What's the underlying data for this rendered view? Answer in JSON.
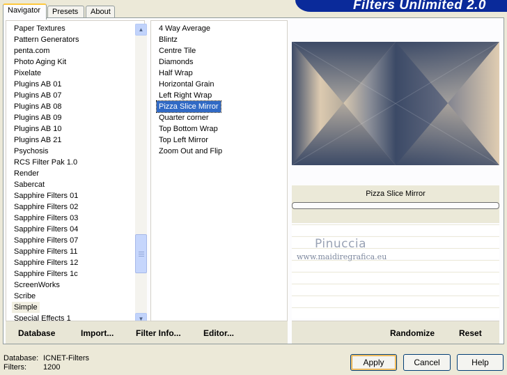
{
  "banner": {
    "title": "Filters Unlimited 2.0"
  },
  "tabs": [
    {
      "label": "Navigator",
      "active": true
    },
    {
      "label": "Presets",
      "active": false
    },
    {
      "label": "About",
      "active": false
    }
  ],
  "categories": {
    "items": [
      "Paper Textures",
      "Pattern Generators",
      "penta.com",
      "Photo Aging Kit",
      "Pixelate",
      "Plugins AB 01",
      "Plugins AB 07",
      "Plugins AB 08",
      "Plugins AB 09",
      "Plugins AB 10",
      "Plugins AB 21",
      "Psychosis",
      "RCS Filter Pak 1.0",
      "Render",
      "Sabercat",
      "Sapphire Filters 01",
      "Sapphire Filters 02",
      "Sapphire Filters 03",
      "Sapphire Filters 04",
      "Sapphire Filters 07",
      "Sapphire Filters 11",
      "Sapphire Filters 12",
      "Sapphire Filters 1c",
      "ScreenWorks",
      "Scribe",
      "Simple",
      "Special Effects 1"
    ],
    "highlighted": "Simple"
  },
  "filters": {
    "items": [
      "4 Way Average",
      "Blintz",
      "Centre Tile",
      "Diamonds",
      "Half Wrap",
      "Horizontal Grain",
      "Left Right Wrap",
      "Pizza Slice Mirror",
      "Quarter corner",
      "Top Bottom Wrap",
      "Top Left Mirror",
      "Zoom Out and Flip"
    ],
    "selected": "Pizza Slice Mirror"
  },
  "left_bar": {
    "database": "Database",
    "import": "Import...",
    "filter_info": "Filter Info...",
    "editor": "Editor..."
  },
  "right_bar": {
    "randomize": "Randomize",
    "reset": "Reset"
  },
  "preview": {
    "filter_name": "Pizza Slice Mirror"
  },
  "watermark": {
    "name": "Pinuccia",
    "url": "www.maidiregrafica.eu"
  },
  "footer": {
    "database_label": "Database:",
    "database_value": "ICNET-Filters",
    "filters_label": "Filters:",
    "filters_value": "1200",
    "apply": "Apply",
    "cancel": "Cancel",
    "help": "Help"
  },
  "colors": {
    "banner": "#0a2a9a",
    "selection": "#316ac5",
    "preview_dark": "#3c4a66",
    "preview_light": "#dccab0"
  }
}
